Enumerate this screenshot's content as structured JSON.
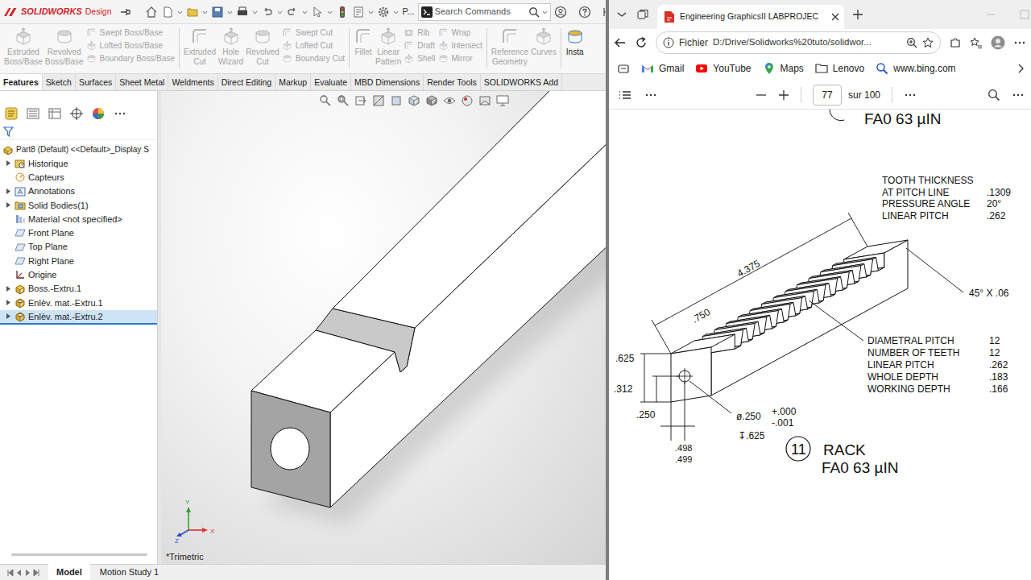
{
  "solidworks": {
    "brand": "SOLIDWORKS",
    "edition": "Design",
    "quick_access_more": "P...",
    "search": {
      "placeholder": "Search Commands"
    },
    "ribbon": [
      {
        "kind": "large",
        "group": 1,
        "items": [
          {
            "label": "Extruded Boss/Base",
            "disabled": true
          }
        ]
      },
      {
        "kind": "large",
        "group": 1,
        "items": [
          {
            "label": "Revolved Boss/Base",
            "disabled": true
          }
        ]
      },
      {
        "kind": "small",
        "group": 1,
        "items": [
          {
            "label": "Swept Boss/Base",
            "disabled": true
          },
          {
            "label": "Lofted Boss/Base",
            "disabled": true
          },
          {
            "label": "Boundary Boss/Base",
            "disabled": true
          }
        ]
      },
      {
        "kind": "large",
        "group": 2,
        "items": [
          {
            "label": "Extruded Cut",
            "disabled": true
          }
        ]
      },
      {
        "kind": "large",
        "group": 2,
        "items": [
          {
            "label": "Hole Wizard",
            "disabled": true
          }
        ]
      },
      {
        "kind": "large",
        "group": 2,
        "items": [
          {
            "label": "Revolved Cut",
            "disabled": true
          }
        ]
      },
      {
        "kind": "small",
        "group": 2,
        "items": [
          {
            "label": "Swept Cut",
            "disabled": true
          },
          {
            "label": "Lofted Cut",
            "disabled": true
          },
          {
            "label": "Boundary Cut",
            "disabled": true
          }
        ]
      },
      {
        "kind": "large",
        "group": 3,
        "items": [
          {
            "label": "Fillet",
            "disabled": true
          }
        ]
      },
      {
        "kind": "large",
        "group": 3,
        "items": [
          {
            "label": "Linear Pattern",
            "disabled": true
          }
        ]
      },
      {
        "kind": "small",
        "group": 3,
        "items": [
          {
            "label": "Rib",
            "disabled": true
          },
          {
            "label": "Draft",
            "disabled": true
          },
          {
            "label": "Shell",
            "disabled": true
          }
        ]
      },
      {
        "kind": "small",
        "group": 3,
        "items": [
          {
            "label": "Wrap",
            "disabled": true
          },
          {
            "label": "Intersect",
            "disabled": true
          },
          {
            "label": "Mirror",
            "disabled": true
          }
        ]
      },
      {
        "kind": "large",
        "group": 4,
        "items": [
          {
            "label": "Reference Geometry",
            "disabled": true
          }
        ]
      },
      {
        "kind": "large",
        "group": 4,
        "items": [
          {
            "label": "Curves",
            "disabled": true
          }
        ]
      },
      {
        "kind": "large",
        "group": 5,
        "items": [
          {
            "label": "Insta",
            "disabled": false
          }
        ]
      }
    ],
    "tabs": [
      {
        "label": "Features",
        "selected": true
      },
      {
        "label": "Sketch",
        "selected": false
      },
      {
        "label": "Surfaces",
        "selected": false
      },
      {
        "label": "Sheet Metal",
        "selected": false
      },
      {
        "label": "Weldments",
        "selected": false
      },
      {
        "label": "Direct Editing",
        "selected": false
      },
      {
        "label": "Markup",
        "selected": false
      },
      {
        "label": "Evaluate",
        "selected": false
      },
      {
        "label": "MBD Dimensions",
        "selected": false
      },
      {
        "label": "Render Tools",
        "selected": false
      },
      {
        "label": "SOLIDWORKS Add",
        "selected": false
      }
    ],
    "tree": {
      "root": {
        "label": "Part8 (Default) <<Default>_Display S",
        "kind": "part"
      },
      "items": [
        {
          "label": "Historique",
          "kind": "history",
          "expandable": true,
          "expanded": false,
          "selected": false
        },
        {
          "label": "Capteurs",
          "kind": "sensor",
          "expandable": false,
          "expanded": false,
          "selected": false
        },
        {
          "label": "Annotations",
          "kind": "annotation",
          "expandable": true,
          "expanded": false,
          "selected": false
        },
        {
          "label": "Solid Bodies(1)",
          "kind": "bodies",
          "expandable": true,
          "expanded": false,
          "selected": false
        },
        {
          "label": "Material <not specified>",
          "kind": "material",
          "expandable": false,
          "expanded": false,
          "selected": false
        },
        {
          "label": "Front Plane",
          "kind": "plane",
          "expandable": false,
          "expanded": false,
          "selected": false
        },
        {
          "label": "Top Plane",
          "kind": "plane",
          "expandable": false,
          "expanded": false,
          "selected": false
        },
        {
          "label": "Right Plane",
          "kind": "plane",
          "expandable": false,
          "expanded": false,
          "selected": false
        },
        {
          "label": "Origine",
          "kind": "origin",
          "expandable": false,
          "expanded": false,
          "selected": false
        },
        {
          "label": "Boss.-Extru.1",
          "kind": "extrude",
          "expandable": true,
          "expanded": false,
          "selected": false
        },
        {
          "label": "Enlèv. mat.-Extru.1",
          "kind": "cut",
          "expandable": true,
          "expanded": false,
          "selected": false
        },
        {
          "label": "Enlèv. mat.-Extru.2",
          "kind": "cut",
          "expandable": true,
          "expanded": false,
          "selected": true
        }
      ]
    },
    "view": {
      "orientation": "*Trimetric",
      "triad": [
        "X",
        "Y",
        "Z"
      ]
    },
    "bottom_tabs": [
      {
        "label": "Model",
        "selected": true
      },
      {
        "label": "Motion Study 1",
        "selected": false
      }
    ]
  },
  "browser": {
    "tabs": [
      {
        "title": "Engineering GraphicsII LABPROJEC",
        "selected": true
      }
    ],
    "address": {
      "scheme": "Fichier",
      "url": "D:/Drive/Solidworks%20tuto/solidwor..."
    },
    "bookmarks": [
      {
        "label": "Gmail",
        "kind": "gmail"
      },
      {
        "label": "YouTube",
        "kind": "youtube"
      },
      {
        "label": "Maps",
        "kind": "maps"
      },
      {
        "label": "Lenovo",
        "kind": "folder"
      },
      {
        "label": "www.bing.com",
        "kind": "search"
      }
    ],
    "pdf_toolbar": {
      "page": "77",
      "total": "sur 100"
    }
  },
  "pdf": {
    "header_note": "FA0 63 µIN",
    "tooth_specs": [
      {
        "label": "TOOTH THICKNESS",
        "value": ""
      },
      {
        "label": "AT PITCH LINE",
        "value": ".1309"
      },
      {
        "label": "PRESSURE ANGLE",
        "value": "20°"
      },
      {
        "label": "LINEAR PITCH",
        "value": ".262"
      }
    ],
    "chamfer": "45° X .06",
    "gear_specs": [
      {
        "label": "DIAMETRAL PITCH",
        "value": "12"
      },
      {
        "label": "NUMBER OF TEETH",
        "value": "12"
      },
      {
        "label": "LINEAR PITCH",
        "value": ".262"
      },
      {
        "label": "WHOLE DEPTH",
        "value": ".183"
      },
      {
        "label": "WORKING DEPTH",
        "value": ".166"
      }
    ],
    "dimensions": {
      "length": "4.375",
      "width": ".750",
      "height": ".625",
      "hole_height": ".312",
      "hole_offset": ".250",
      "hole_pos_min": ".498",
      "hole_pos_max": ".499"
    },
    "hole": {
      "diameter": "ø.250",
      "tol_plus": "+.000",
      "tol_minus": "-.001",
      "depth": "↧.625"
    },
    "title": {
      "number": "11",
      "name": "RACK",
      "finish": "FA0 63 µIN"
    }
  }
}
